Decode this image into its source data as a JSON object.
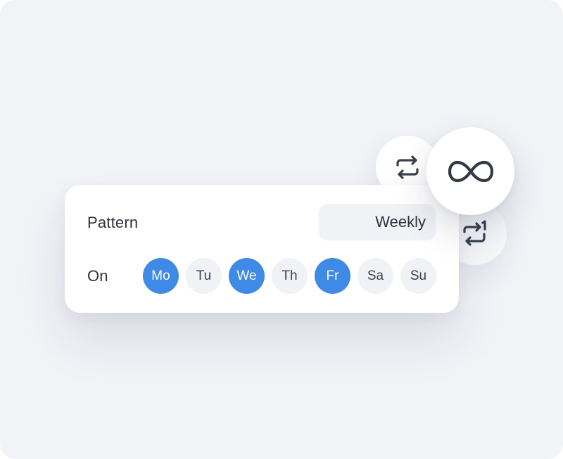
{
  "pattern": {
    "label": "Pattern",
    "value": "Weekly"
  },
  "schedule": {
    "label": "On",
    "days": [
      {
        "label": "Mo",
        "selected": true
      },
      {
        "label": "Tu",
        "selected": false
      },
      {
        "label": "We",
        "selected": true
      },
      {
        "label": "Th",
        "selected": false
      },
      {
        "label": "Fr",
        "selected": true
      },
      {
        "label": "Sa",
        "selected": false
      },
      {
        "label": "Su",
        "selected": false
      }
    ]
  },
  "repeat_options": [
    {
      "name": "repeat",
      "icon": "repeat-icon"
    },
    {
      "name": "infinite",
      "icon": "infinity-icon"
    },
    {
      "name": "repeat-once",
      "icon": "repeat-one-icon"
    }
  ],
  "colors": {
    "background": "#f2f3f7",
    "accent": "#3e8ae6",
    "text": "#2c333d",
    "chip": "#f1f2f6"
  }
}
